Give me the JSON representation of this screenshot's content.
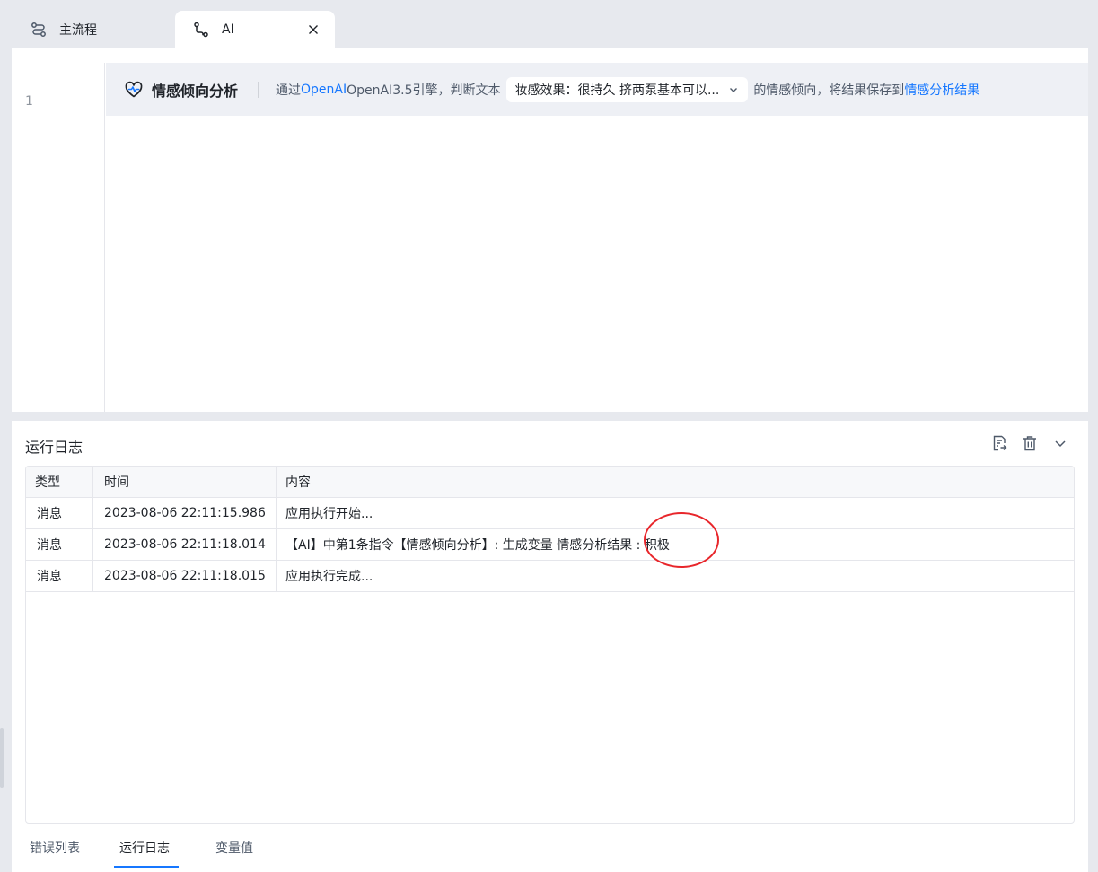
{
  "tabs": {
    "main": {
      "label": "主流程",
      "icon": "flow-icon"
    },
    "ai": {
      "label": "AI",
      "icon": "branch-icon"
    }
  },
  "editor": {
    "line_number": "1",
    "command": {
      "icon": "heart-pulse-icon",
      "title": "情感倾向分析",
      "text_prefix": "通过",
      "engine_link": "OpenAI",
      "engine_text": "OpenAI3.5引擎，判断文本",
      "text_select_value": "妆感效果：很持久 挤两泵基本可以...",
      "text_after": "的情感倾向，将结果保存到",
      "result_var_link": "情感分析结果"
    }
  },
  "log": {
    "title": "运行日志",
    "columns": [
      "类型",
      "时间",
      "内容"
    ],
    "rows": [
      {
        "type": "消息",
        "time": "2023-08-06 22:11:15.986",
        "content": "应用执行开始..."
      },
      {
        "type": "消息",
        "time": "2023-08-06 22:11:18.014",
        "content": "【AI】中第1条指令【情感倾向分析】: 生成变量 情感分析结果 : 积极"
      },
      {
        "type": "消息",
        "time": "2023-08-06 22:11:18.015",
        "content": "应用执行完成..."
      }
    ]
  },
  "bottom_tabs": [
    {
      "label": "错误列表"
    },
    {
      "label": "运行日志",
      "active": true
    },
    {
      "label": "变量值"
    }
  ],
  "colors": {
    "link": "#1677ff",
    "annotation": "#e8262b",
    "command_bg": "#eef0f5"
  }
}
